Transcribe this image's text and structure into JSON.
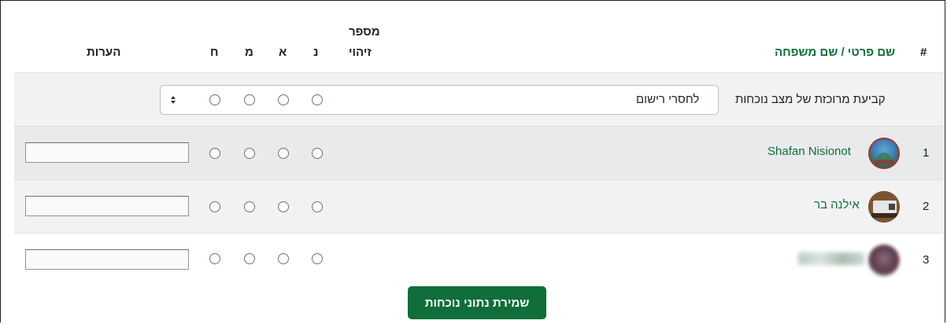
{
  "header": {
    "num_col": "#",
    "name_col": "שם פרטי / שם משפחה",
    "id_col_line1": "מספר",
    "id_col_line2": "זיהוי",
    "status_n": "נ",
    "status_a": "א",
    "status_m": "מ",
    "status_h": "ח",
    "notes_col": "הערות"
  },
  "bulk": {
    "label": "קביעת מרוכזת של מצב נוכחות",
    "select_value": "לחסרי רישום"
  },
  "rows": [
    {
      "num": "1",
      "name": "Shafan Nisionot"
    },
    {
      "num": "2",
      "name": "אילנה בר"
    },
    {
      "num": "3",
      "name": ""
    }
  ],
  "save_button": "שמירת נתוני נוכחות",
  "colors": {
    "accent": "#0f6e3a",
    "band": "#f2f2f2",
    "band_dark": "#e9eaeb"
  }
}
